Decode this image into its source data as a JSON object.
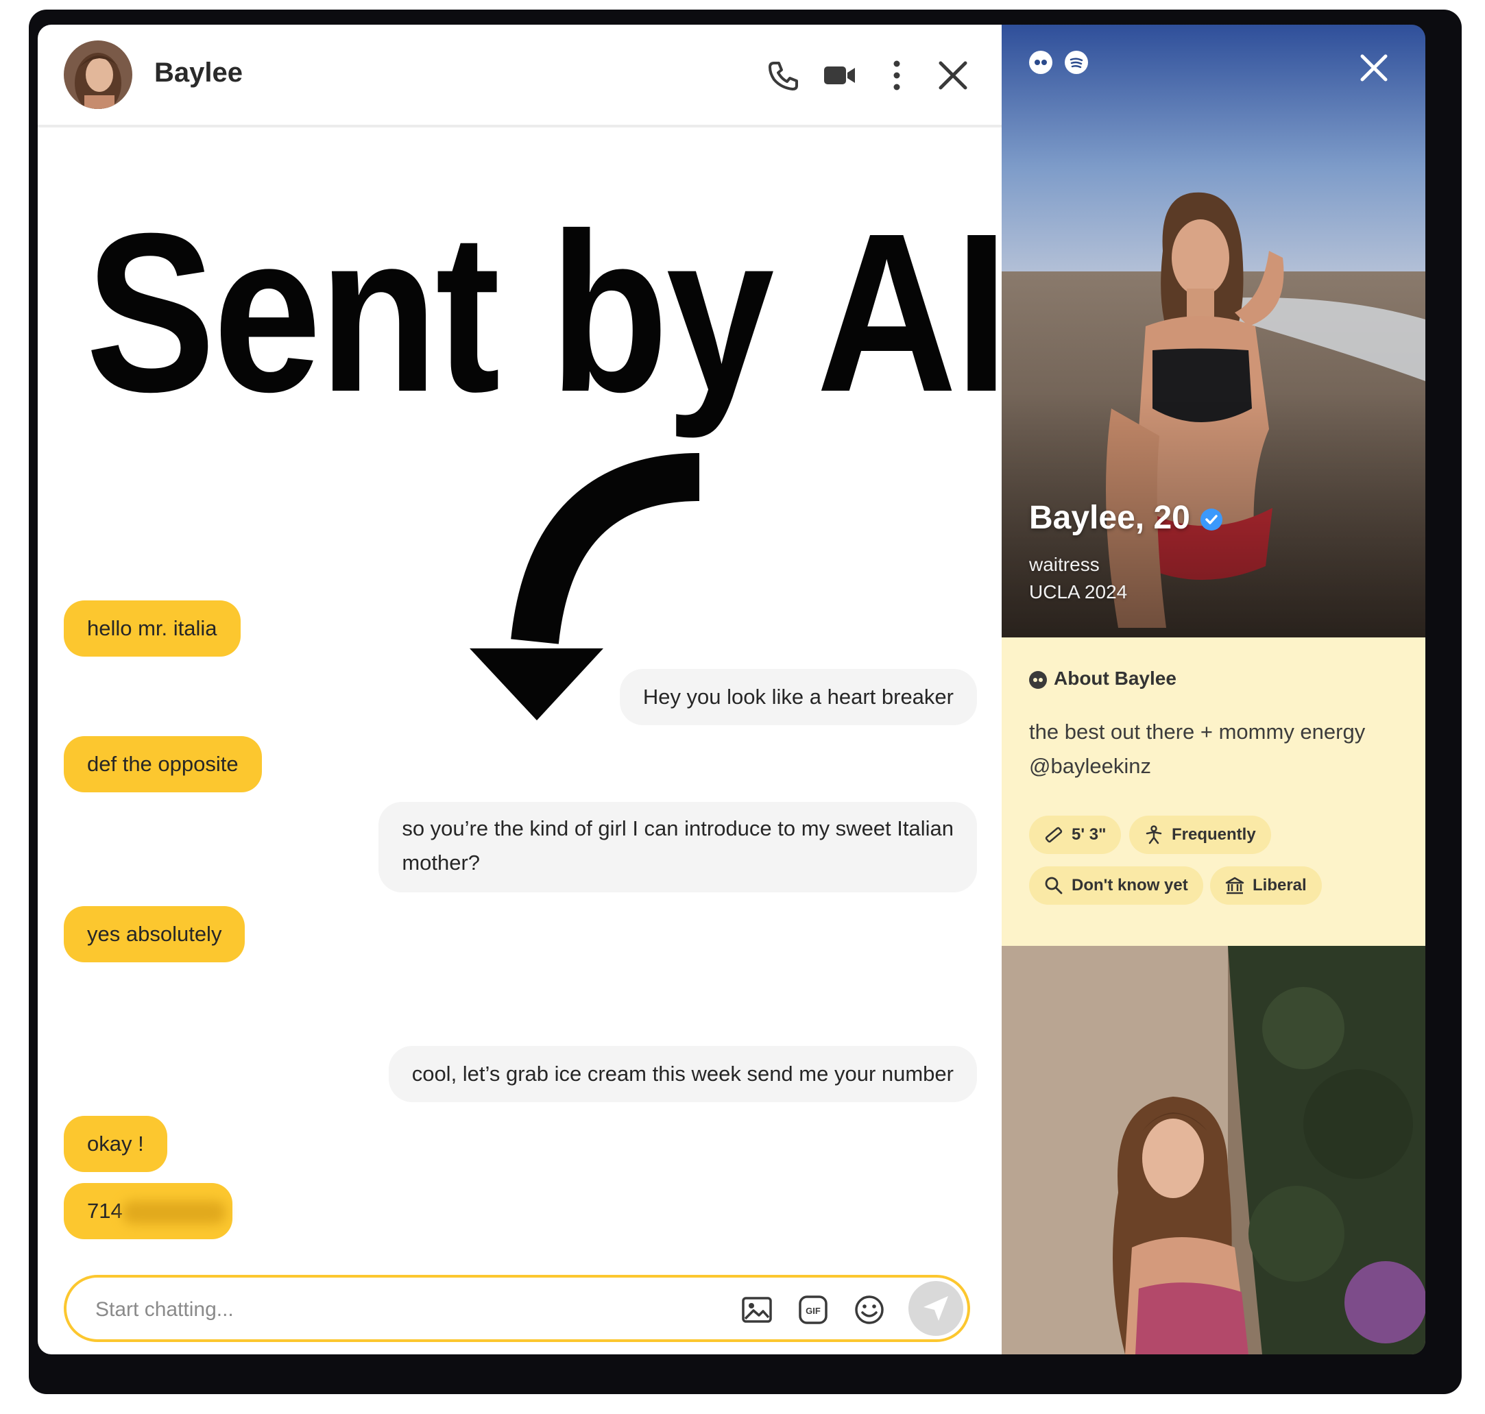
{
  "chat": {
    "contact_name": "Baylee",
    "overlay_title": "Sent by AI",
    "messages": [
      {
        "side": "in",
        "text": "hello mr. italia"
      },
      {
        "side": "out",
        "text": "Hey you look like a heart breaker"
      },
      {
        "side": "in",
        "text": "def the opposite"
      },
      {
        "side": "out",
        "line1": "so you’re the kind of girl I can introduce to my sweet Italian",
        "line2": "mother?"
      },
      {
        "side": "in",
        "text": "yes absolutely"
      },
      {
        "side": "out",
        "text": "cool, let’s grab ice cream this week send me your number"
      },
      {
        "side": "in",
        "text": "okay !"
      },
      {
        "side": "in",
        "text": "714"
      }
    ],
    "composer_placeholder": "Start chatting...",
    "icons": {
      "call": "phone-icon",
      "video": "video-icon",
      "more": "more-vertical-icon",
      "close": "close-icon",
      "image": "image-icon",
      "gif": "gif-icon",
      "emoji": "emoji-icon",
      "send": "send-icon"
    }
  },
  "profile": {
    "name_age": "Baylee, 20",
    "job": "waitress",
    "school": "UCLA 2024",
    "about_heading": "About Baylee",
    "bio_line1": "the best out there + mommy energy",
    "bio_line2": "@bayleekinz",
    "chips": [
      {
        "icon": "ruler-icon",
        "label": "5' 3\""
      },
      {
        "icon": "exercise-icon",
        "label": "Frequently"
      },
      {
        "icon": "search-icon",
        "label": "Don't know yet"
      },
      {
        "icon": "politics-icon",
        "label": "Liberal"
      }
    ]
  },
  "colors": {
    "accent_yellow": "#fcc72f",
    "outgoing_bubble": "#f4f4f4",
    "about_background": "#fdf3c9",
    "chip_background": "#fae9a6",
    "verified_blue": "#3b99fc",
    "frame": "#0c0c10"
  }
}
